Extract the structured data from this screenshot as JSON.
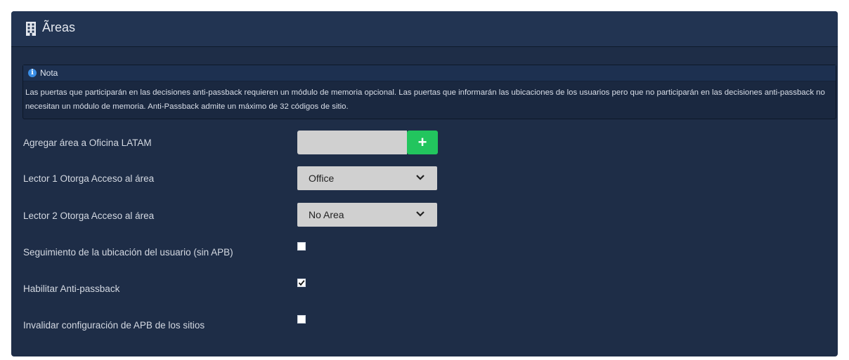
{
  "panel": {
    "title": "Ãreas",
    "icon": "building-icon"
  },
  "note": {
    "icon": "info-icon",
    "title": "Nota",
    "text": "Las puertas que participarán en las decisiones anti-passback requieren un módulo de memoria opcional. Las puertas que informarán las ubicaciones de los usuarios pero que no participarán en las decisiones anti-passback no necesitan un módulo de memoria. Anti-Passback admite un máximo de 32 códigos de sitio."
  },
  "form": {
    "add_area": {
      "label": "Agregar área a Oficina LATAM",
      "value": "",
      "button_icon": "plus-icon"
    },
    "reader1": {
      "label": "Lector 1 Otorga Acceso al área",
      "selected": "Office"
    },
    "reader2": {
      "label": "Lector 2 Otorga Acceso al área",
      "selected": "No Area"
    },
    "tracking": {
      "label": "Seguimiento de la ubicación del usuario (sin APB)",
      "checked": false
    },
    "antipassback": {
      "label": "Habilitar Anti-passback",
      "checked": true
    },
    "override": {
      "label": "Invalidar configuración de APB de los sitios",
      "checked": false
    }
  },
  "colors": {
    "panel_bg": "#1e2d47",
    "header_bg": "#223452",
    "accent_green": "#22c55e",
    "info_blue": "#3a8ee6"
  }
}
